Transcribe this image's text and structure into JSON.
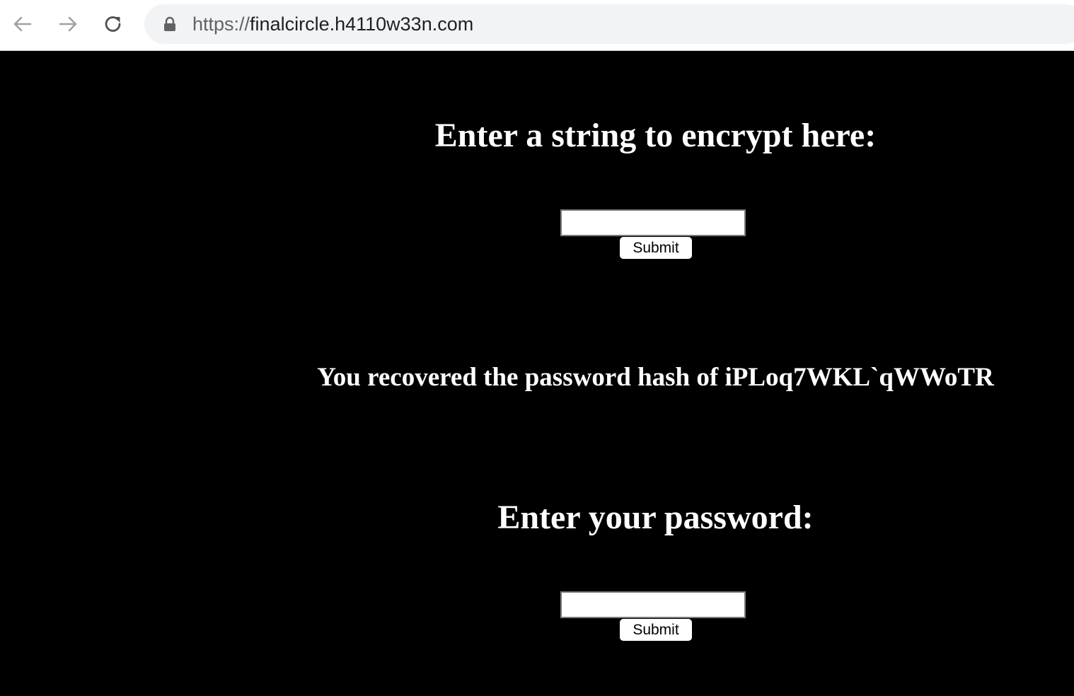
{
  "browser": {
    "url_scheme": "https://",
    "url_host": "finalcircle.h4110w33n.com",
    "icons": {
      "back": "arrow-left-icon",
      "forward": "arrow-right-icon",
      "reload": "reload-icon",
      "lock": "lock-icon"
    }
  },
  "encrypt_form": {
    "heading": "Enter a string to encrypt here:",
    "input_value": "",
    "submit_label": "Submit"
  },
  "result": {
    "message": "You recovered the password hash of iPLoq7WKL`qWWoTR"
  },
  "password_form": {
    "heading": "Enter your password:",
    "input_value": "",
    "submit_label": "Submit"
  },
  "colors": {
    "page_background": "#000000",
    "text": "#ffffff"
  }
}
